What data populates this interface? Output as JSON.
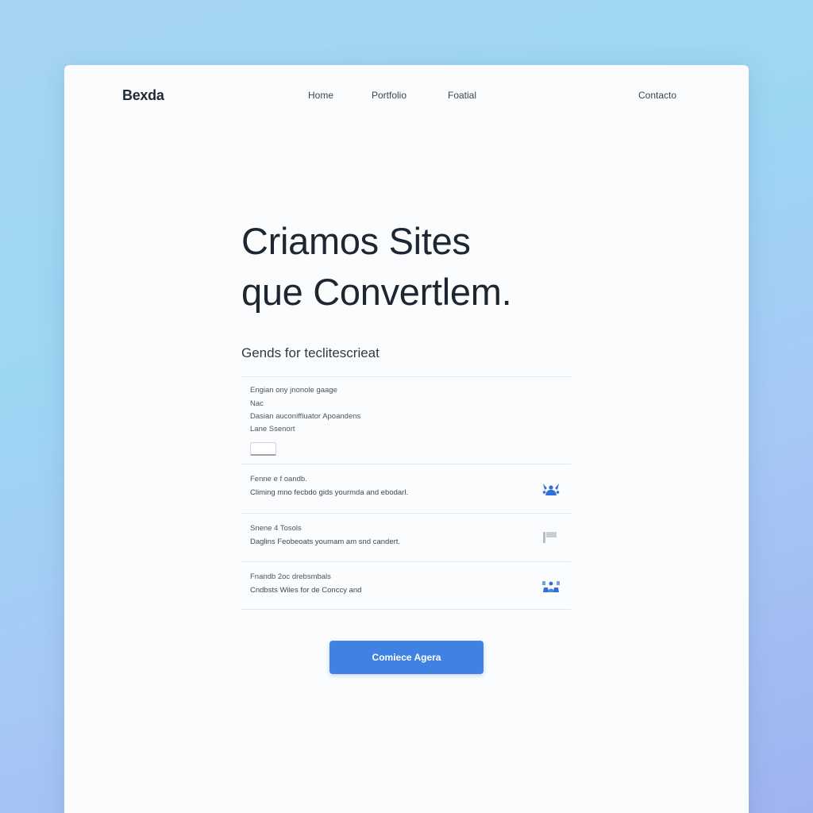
{
  "header": {
    "logo": "Bexda",
    "nav": {
      "home": "Home",
      "portfolio": "Portfolio",
      "third": "Foatial",
      "contact": "Contacto"
    }
  },
  "hero": {
    "line1": "Criamos Sites",
    "line2": "que Convertlem."
  },
  "subtitle": "Gends for teclitescrieat",
  "form": {
    "lines": [
      "Engian ony jnonole gaage",
      "Nac",
      "Dasian auconiffiuator Apoandens",
      "Lane Ssenort"
    ]
  },
  "rows": [
    {
      "title": "Fenne e f oandb.",
      "desc": "Climing mno fecbdo gids yourmda and ebodarl.",
      "icon": "people-icon"
    },
    {
      "title": "Snene 4 Tosols",
      "desc": "Daglins Feobeoats youmam am snd candert.",
      "icon": "flag-icon"
    },
    {
      "title": "Fnandb 2oc drebsmbals",
      "desc": "Cndbsts Wiles for de Conccy and",
      "icon": "group-icon"
    }
  ],
  "cta": {
    "label": "Comiece Agera"
  },
  "colors": {
    "accent": "#3f82e3",
    "icon_blue": "#2f6fd6",
    "icon_gray": "#b9bec4",
    "card_bg": "#fbfcfd",
    "background_gradient": [
      "#a7d4f4",
      "#9dd6f3",
      "#9fb3f0"
    ]
  }
}
